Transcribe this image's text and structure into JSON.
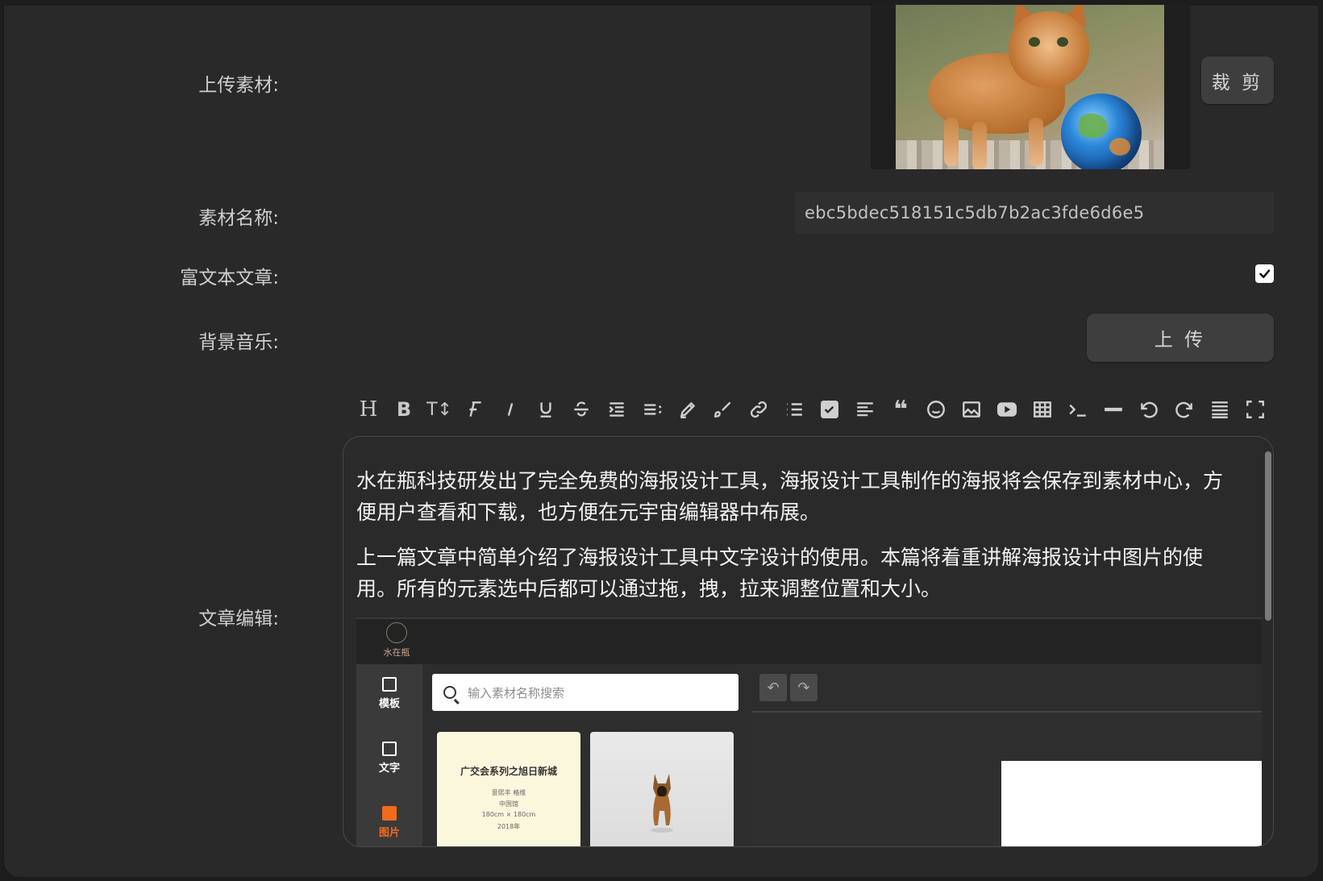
{
  "form": {
    "upload_label": "上传素材:",
    "crop_button": "裁 剪",
    "name_label": "素材名称:",
    "name_value": "ebc5bdec518151c5db7b2ac3fde6d6e5",
    "rich_label": "富文本文章:",
    "rich_checked": true,
    "music_label": "背景音乐:",
    "upload_button": "上 传",
    "editor_label": "文章编辑:"
  },
  "toolbar": {
    "icons": [
      "heading-icon",
      "bold-icon",
      "text-size-icon",
      "font-icon",
      "italic-icon",
      "underline-icon",
      "strikethrough-icon",
      "indent-icon",
      "line-height-icon",
      "highlight-icon",
      "brush-icon",
      "link-icon",
      "bullet-list-icon",
      "checklist-icon",
      "align-icon",
      "quote-icon",
      "emoji-icon",
      "image-icon",
      "video-icon",
      "table-icon",
      "code-icon",
      "divider-icon",
      "undo-icon",
      "redo-icon",
      "clear-format-icon",
      "fullscreen-icon"
    ],
    "heading": "H",
    "bold": "B",
    "text_size": "T↕",
    "quote": "❝"
  },
  "editor": {
    "paragraph1": "水在瓶科技研发出了完全免费的海报设计工具，海报设计工具制作的海报将会保存到素材中心，方便用户查看和下载，也方便在元宇宙编辑器中布展。",
    "paragraph2": "上一篇文章中简单介绍了海报设计工具中文字设计的使用。本篇将着重讲解海报设计中图片的使用。所有的元素选中后都可以通过拖，拽，拉来调整位置和大小。",
    "embedded": {
      "logo_text": "水在瓶",
      "side_items": [
        "模板",
        "文字",
        "图片"
      ],
      "search_placeholder": "输入素材名称搜索",
      "card1_title": "广交会系列之旭日新城",
      "card1_lines": [
        "意熙丰 格维",
        "中国馆",
        "180cm × 180cm",
        "2018年"
      ]
    }
  },
  "colors": {
    "background": "#292929",
    "accent_orange": "#f26b1d",
    "button": "#3e3e3e"
  }
}
